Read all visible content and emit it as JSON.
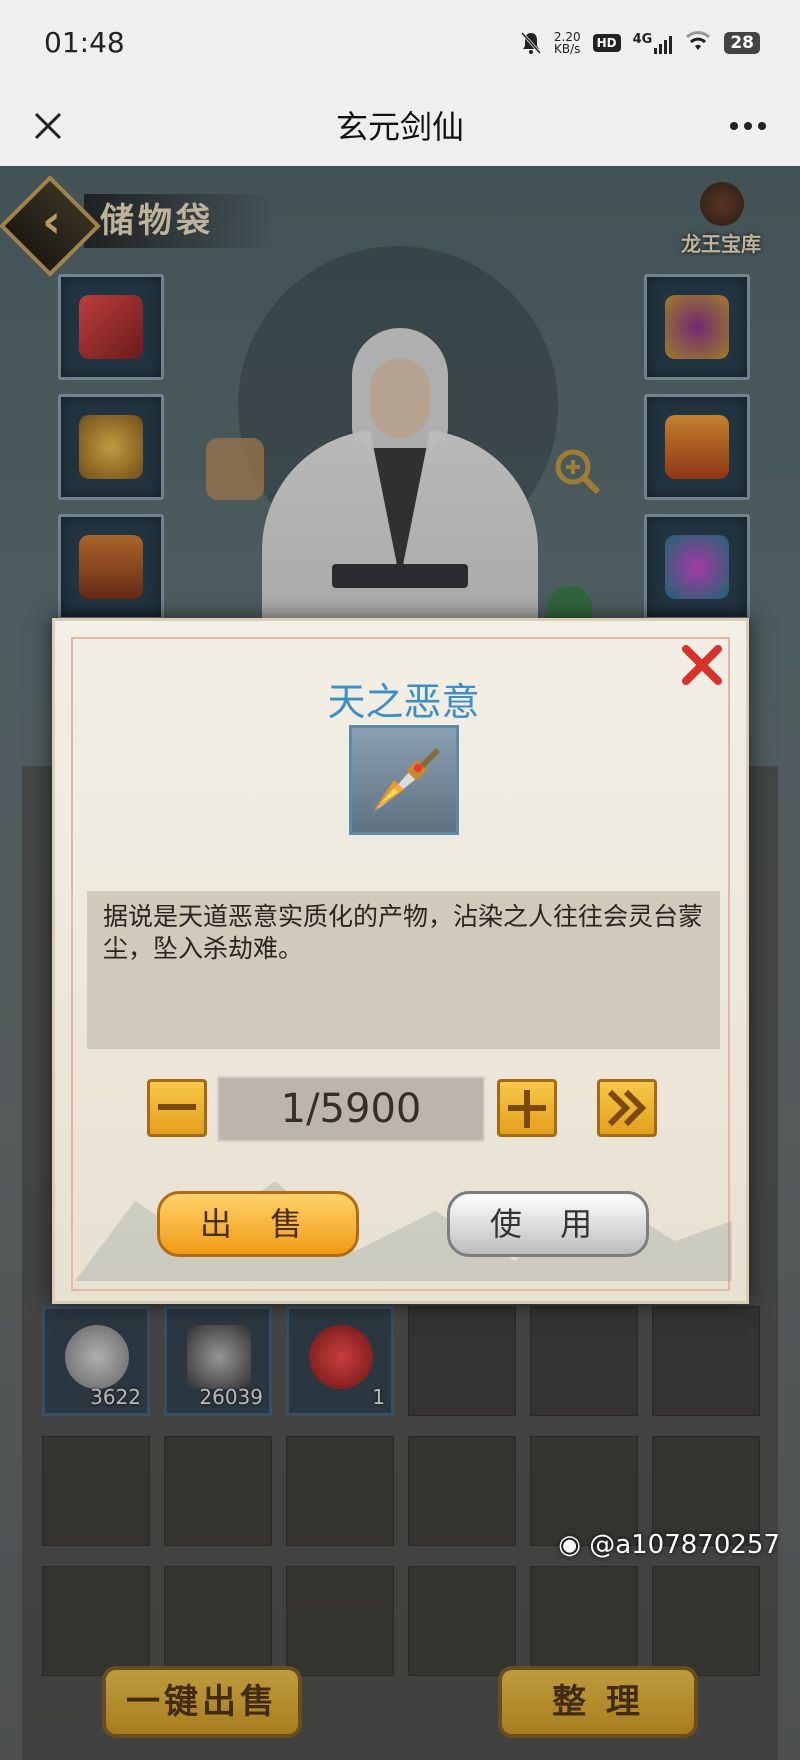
{
  "status_bar": {
    "time": "01:48",
    "net_speed_value": "2.20",
    "net_speed_unit": "KB/s",
    "hd_badge": "HD",
    "network": "4G",
    "battery": "28"
  },
  "title_bar": {
    "title": "玄元剑仙"
  },
  "bag": {
    "title": "储物袋",
    "treasury_label": "龙王宝库",
    "equipment_slots": {
      "left": [
        "sword-icon",
        "helmet-icon",
        "armor-icon"
      ],
      "right": [
        "ring-icon",
        "lantern-icon",
        "amulet-icon"
      ]
    },
    "inventory_counts": [
      "3622",
      "26039",
      "1"
    ],
    "sell_all_label": "一键出售",
    "sort_label": "整 理"
  },
  "dialog": {
    "title": "天之恶意",
    "item_icon": "flaming-dagger-icon",
    "description": "据说是天道恶意实质化的产物，沾染之人往往会灵台蒙尘，坠入杀劫难。",
    "quantity": "1/5900",
    "sell_label": "出 售",
    "use_label": "使 用"
  },
  "watermark": "@a107870257",
  "colors": {
    "title_blue": "#3a8fc7",
    "gold": "#f0b22c",
    "close_red": "#d8322a"
  }
}
